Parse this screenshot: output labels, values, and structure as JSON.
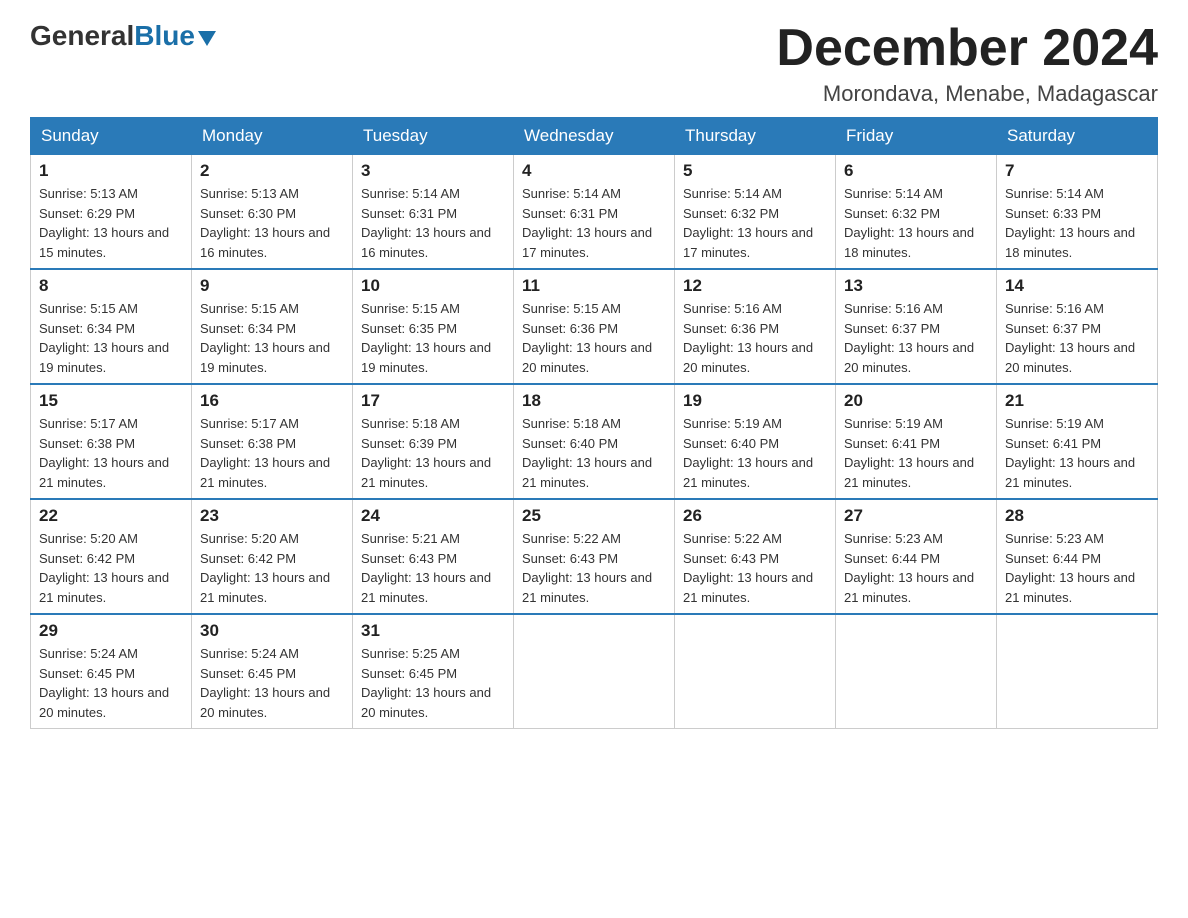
{
  "header": {
    "logo_general": "General",
    "logo_blue": "Blue",
    "month_title": "December 2024",
    "location": "Morondava, Menabe, Madagascar"
  },
  "weekdays": [
    "Sunday",
    "Monday",
    "Tuesday",
    "Wednesday",
    "Thursday",
    "Friday",
    "Saturday"
  ],
  "weeks": [
    [
      {
        "day": "1",
        "sunrise": "5:13 AM",
        "sunset": "6:29 PM",
        "daylight": "13 hours and 15 minutes."
      },
      {
        "day": "2",
        "sunrise": "5:13 AM",
        "sunset": "6:30 PM",
        "daylight": "13 hours and 16 minutes."
      },
      {
        "day": "3",
        "sunrise": "5:14 AM",
        "sunset": "6:31 PM",
        "daylight": "13 hours and 16 minutes."
      },
      {
        "day": "4",
        "sunrise": "5:14 AM",
        "sunset": "6:31 PM",
        "daylight": "13 hours and 17 minutes."
      },
      {
        "day": "5",
        "sunrise": "5:14 AM",
        "sunset": "6:32 PM",
        "daylight": "13 hours and 17 minutes."
      },
      {
        "day": "6",
        "sunrise": "5:14 AM",
        "sunset": "6:32 PM",
        "daylight": "13 hours and 18 minutes."
      },
      {
        "day": "7",
        "sunrise": "5:14 AM",
        "sunset": "6:33 PM",
        "daylight": "13 hours and 18 minutes."
      }
    ],
    [
      {
        "day": "8",
        "sunrise": "5:15 AM",
        "sunset": "6:34 PM",
        "daylight": "13 hours and 19 minutes."
      },
      {
        "day": "9",
        "sunrise": "5:15 AM",
        "sunset": "6:34 PM",
        "daylight": "13 hours and 19 minutes."
      },
      {
        "day": "10",
        "sunrise": "5:15 AM",
        "sunset": "6:35 PM",
        "daylight": "13 hours and 19 minutes."
      },
      {
        "day": "11",
        "sunrise": "5:15 AM",
        "sunset": "6:36 PM",
        "daylight": "13 hours and 20 minutes."
      },
      {
        "day": "12",
        "sunrise": "5:16 AM",
        "sunset": "6:36 PM",
        "daylight": "13 hours and 20 minutes."
      },
      {
        "day": "13",
        "sunrise": "5:16 AM",
        "sunset": "6:37 PM",
        "daylight": "13 hours and 20 minutes."
      },
      {
        "day": "14",
        "sunrise": "5:16 AM",
        "sunset": "6:37 PM",
        "daylight": "13 hours and 20 minutes."
      }
    ],
    [
      {
        "day": "15",
        "sunrise": "5:17 AM",
        "sunset": "6:38 PM",
        "daylight": "13 hours and 21 minutes."
      },
      {
        "day": "16",
        "sunrise": "5:17 AM",
        "sunset": "6:38 PM",
        "daylight": "13 hours and 21 minutes."
      },
      {
        "day": "17",
        "sunrise": "5:18 AM",
        "sunset": "6:39 PM",
        "daylight": "13 hours and 21 minutes."
      },
      {
        "day": "18",
        "sunrise": "5:18 AM",
        "sunset": "6:40 PM",
        "daylight": "13 hours and 21 minutes."
      },
      {
        "day": "19",
        "sunrise": "5:19 AM",
        "sunset": "6:40 PM",
        "daylight": "13 hours and 21 minutes."
      },
      {
        "day": "20",
        "sunrise": "5:19 AM",
        "sunset": "6:41 PM",
        "daylight": "13 hours and 21 minutes."
      },
      {
        "day": "21",
        "sunrise": "5:19 AM",
        "sunset": "6:41 PM",
        "daylight": "13 hours and 21 minutes."
      }
    ],
    [
      {
        "day": "22",
        "sunrise": "5:20 AM",
        "sunset": "6:42 PM",
        "daylight": "13 hours and 21 minutes."
      },
      {
        "day": "23",
        "sunrise": "5:20 AM",
        "sunset": "6:42 PM",
        "daylight": "13 hours and 21 minutes."
      },
      {
        "day": "24",
        "sunrise": "5:21 AM",
        "sunset": "6:43 PM",
        "daylight": "13 hours and 21 minutes."
      },
      {
        "day": "25",
        "sunrise": "5:22 AM",
        "sunset": "6:43 PM",
        "daylight": "13 hours and 21 minutes."
      },
      {
        "day": "26",
        "sunrise": "5:22 AM",
        "sunset": "6:43 PM",
        "daylight": "13 hours and 21 minutes."
      },
      {
        "day": "27",
        "sunrise": "5:23 AM",
        "sunset": "6:44 PM",
        "daylight": "13 hours and 21 minutes."
      },
      {
        "day": "28",
        "sunrise": "5:23 AM",
        "sunset": "6:44 PM",
        "daylight": "13 hours and 21 minutes."
      }
    ],
    [
      {
        "day": "29",
        "sunrise": "5:24 AM",
        "sunset": "6:45 PM",
        "daylight": "13 hours and 20 minutes."
      },
      {
        "day": "30",
        "sunrise": "5:24 AM",
        "sunset": "6:45 PM",
        "daylight": "13 hours and 20 minutes."
      },
      {
        "day": "31",
        "sunrise": "5:25 AM",
        "sunset": "6:45 PM",
        "daylight": "13 hours and 20 minutes."
      },
      null,
      null,
      null,
      null
    ]
  ]
}
